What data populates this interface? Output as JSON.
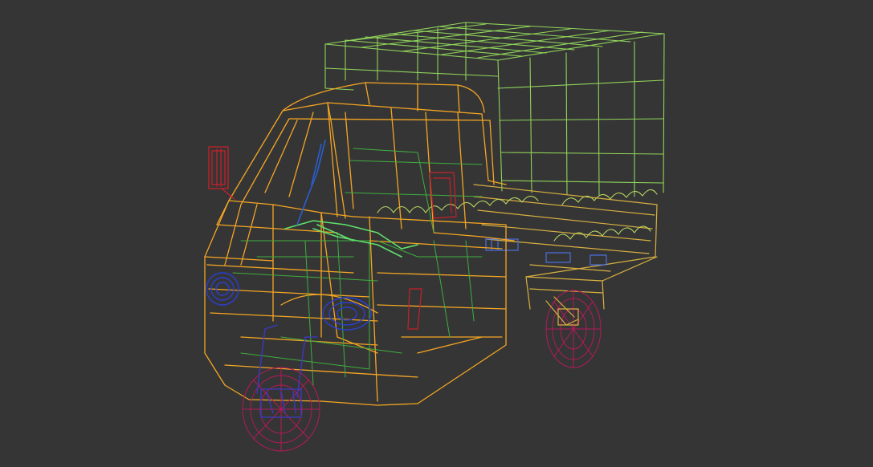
{
  "scene": {
    "background_color": "#353535",
    "object": "three-wheeler-pickup-wireframe",
    "colors": {
      "cargo_canopy": "#8fd45a",
      "cabin_body": "#f5a623",
      "cabin_inner": "#3fae3f",
      "headlight": "#2a3fd0",
      "wheel": "#b5195a",
      "mirror": "#c8202a",
      "steering": "#2a5fd0",
      "dashboard": "#5fe06a",
      "cargo_bed": "#d8b040",
      "cargo_detail": "#4a6fe0"
    }
  }
}
